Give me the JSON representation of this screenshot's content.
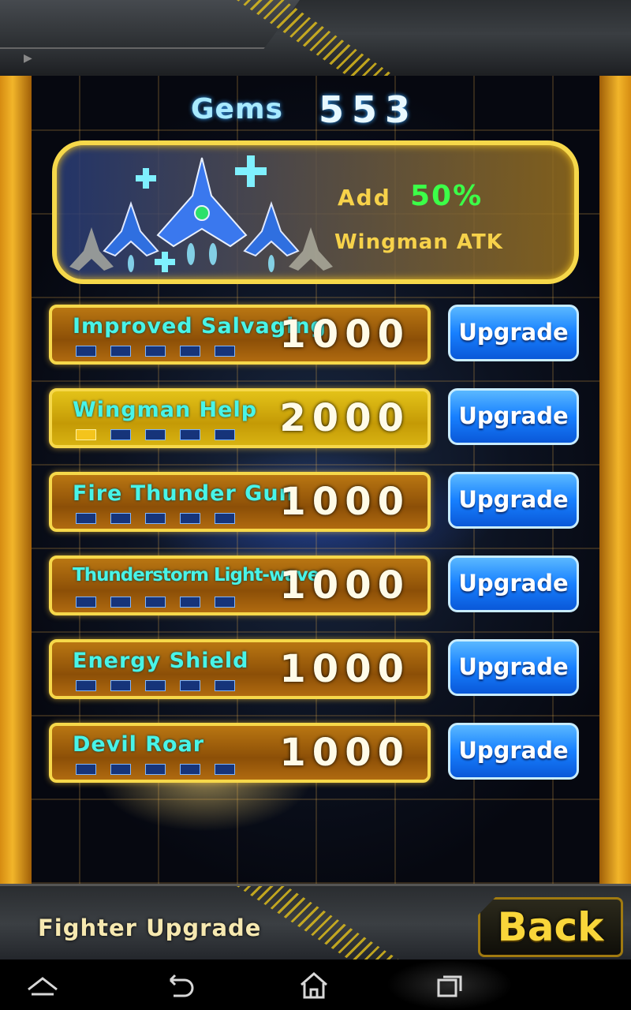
{
  "header": {
    "gems_label": "Gems",
    "gems_value": "553"
  },
  "banner": {
    "add_label": "Add",
    "bonus": "50%",
    "stat": "Wingman ATK"
  },
  "upgrades": [
    {
      "name": "Improved Salvaging",
      "cost": "1000",
      "button": "Upgrade",
      "level": 0
    },
    {
      "name": "Wingman Help",
      "cost": "2000",
      "button": "Upgrade",
      "level": 1
    },
    {
      "name": "Fire Thunder Gun",
      "cost": "1000",
      "button": "Upgrade",
      "level": 0
    },
    {
      "name": "Thunderstorm Light-wave",
      "cost": "1000",
      "button": "Upgrade",
      "level": 0
    },
    {
      "name": "Energy Shield",
      "cost": "1000",
      "button": "Upgrade",
      "level": 0
    },
    {
      "name": "Devil Roar",
      "cost": "1000",
      "button": "Upgrade",
      "level": 0
    }
  ],
  "footer": {
    "title": "Fighter Upgrade",
    "back_label": "Back"
  },
  "navbar": {
    "icons": [
      "back-arrow-icon",
      "back-icon",
      "home-icon",
      "recent-apps-icon"
    ]
  }
}
